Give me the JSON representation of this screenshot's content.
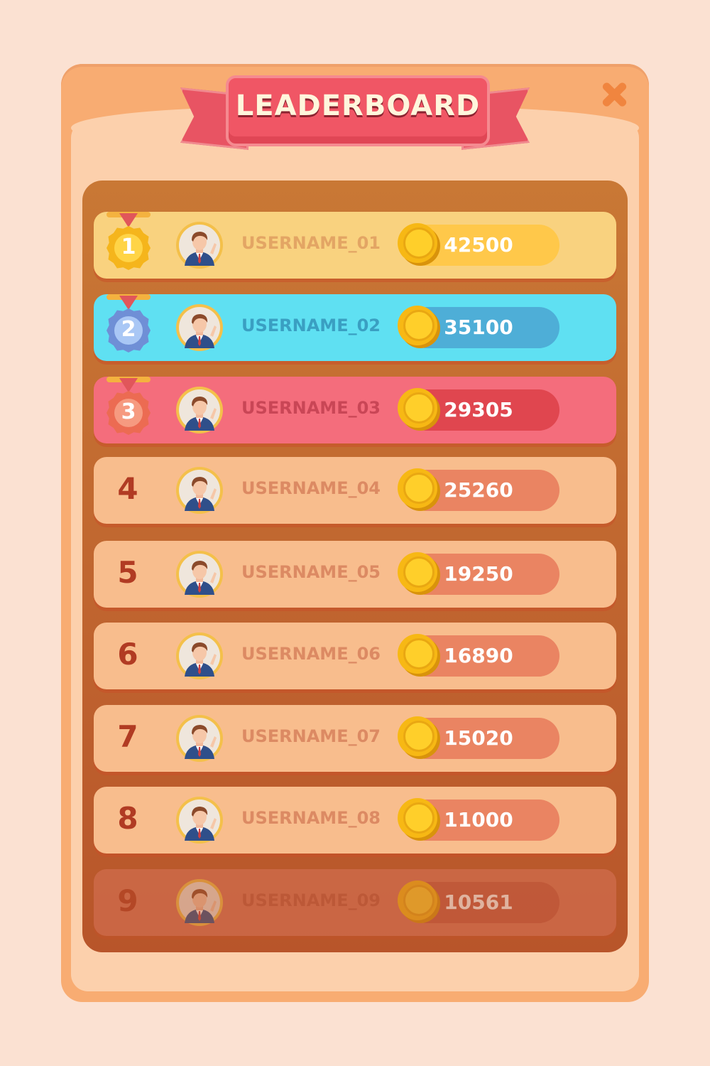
{
  "title": "LEADERBOARD",
  "close_icon": "close-icon",
  "rows": [
    {
      "rank": "1",
      "username": "USERNAME_01",
      "score": "42500",
      "medal": "gold",
      "bg": "#f9d27f",
      "name_color": "#e3a564",
      "pill": "#ffc84a"
    },
    {
      "rank": "2",
      "username": "USERNAME_02",
      "score": "35100",
      "medal": "silver",
      "bg": "#5fe0f2",
      "name_color": "#3a9fc2",
      "pill": "#4eaed7"
    },
    {
      "rank": "3",
      "username": "USERNAME_03",
      "score": "29305",
      "medal": "bronze",
      "bg": "#f46d7c",
      "name_color": "#c94656",
      "pill": "#e0464f"
    },
    {
      "rank": "4",
      "username": "USERNAME_04",
      "score": "25260",
      "medal": "",
      "bg": "#f8bd8d",
      "name_color": "#dc8a63",
      "pill": "#ea8462"
    },
    {
      "rank": "5",
      "username": "USERNAME_05",
      "score": "19250",
      "medal": "",
      "bg": "#f8bd8d",
      "name_color": "#dc8a63",
      "pill": "#ea8462"
    },
    {
      "rank": "6",
      "username": "USERNAME_06",
      "score": "16890",
      "medal": "",
      "bg": "#f8bd8d",
      "name_color": "#dc8a63",
      "pill": "#ea8462"
    },
    {
      "rank": "7",
      "username": "USERNAME_07",
      "score": "15020",
      "medal": "",
      "bg": "#f8bd8d",
      "name_color": "#dc8a63",
      "pill": "#ea8462"
    },
    {
      "rank": "8",
      "username": "USERNAME_08",
      "score": "11000",
      "medal": "",
      "bg": "#f8bd8d",
      "name_color": "#dc8a63",
      "pill": "#ea8462"
    },
    {
      "rank": "9",
      "username": "USERNAME_09",
      "score": "10561",
      "medal": "",
      "bg": "#d8745a",
      "name_color": "#c05a42",
      "pill": "#c65a45",
      "faded": true
    }
  ]
}
